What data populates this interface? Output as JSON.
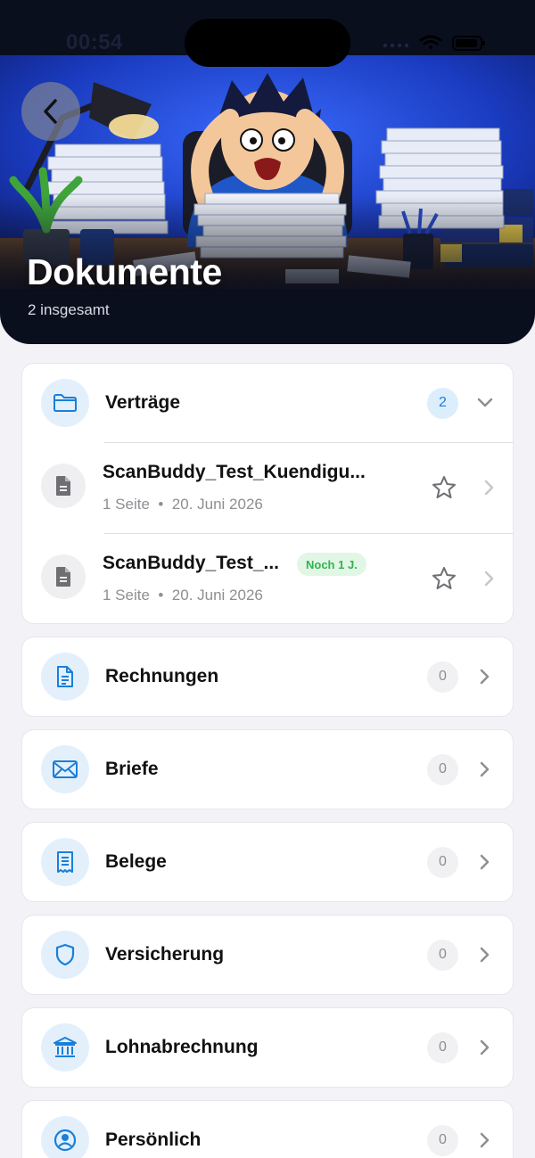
{
  "status_bar": {
    "time": "00:54"
  },
  "header": {
    "title": "Dokumente",
    "subtitle": "2 insgesamt"
  },
  "categories": [
    {
      "label": "Verträge",
      "count": "2",
      "icon": "folder-icon",
      "expanded": true,
      "documents": [
        {
          "name": "ScanBuddy_Test_Kuendigu...",
          "pages": "1 Seite",
          "separator": "•",
          "date": "20. Juni 2026",
          "badge": ""
        },
        {
          "name": "ScanBuddy_Test_...",
          "pages": "1 Seite",
          "separator": "•",
          "date": "20. Juni 2026",
          "badge": "Noch 1 J."
        }
      ]
    },
    {
      "label": "Rechnungen",
      "count": "0",
      "icon": "invoice-icon"
    },
    {
      "label": "Briefe",
      "count": "0",
      "icon": "envelope-icon"
    },
    {
      "label": "Belege",
      "count": "0",
      "icon": "receipt-icon"
    },
    {
      "label": "Versicherung",
      "count": "0",
      "icon": "shield-icon"
    },
    {
      "label": "Lohnabrechnung",
      "count": "0",
      "icon": "bank-icon"
    },
    {
      "label": "Persönlich",
      "count": "0",
      "icon": "person-icon"
    }
  ],
  "colors": {
    "accent": "#1a7fd9",
    "badge_green": "#2fb44e",
    "background": "#f2f2f7"
  }
}
